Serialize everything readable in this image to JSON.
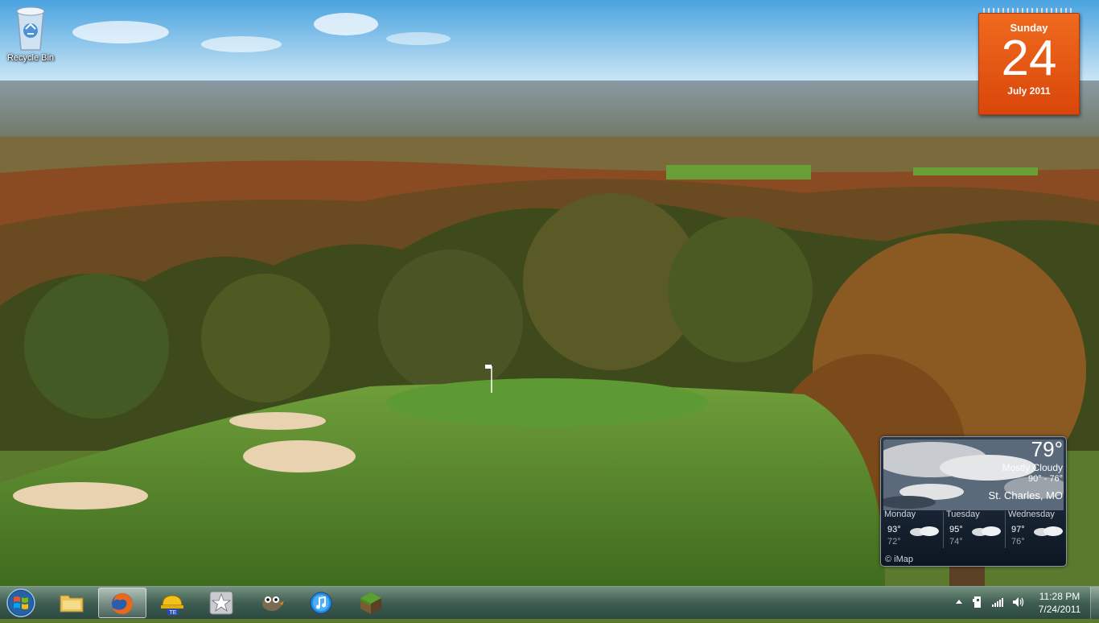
{
  "desktop": {
    "icons": [
      {
        "label": "Recycle Bin",
        "icon": "recycle-bin-icon"
      }
    ]
  },
  "calendar": {
    "weekday": "Sunday",
    "day": "24",
    "month_year": "July 2011"
  },
  "weather": {
    "temperature": "79°",
    "condition": "Mostly Cloudy",
    "range": "90° - 76°",
    "location": "St. Charles, MO",
    "forecast": [
      {
        "day": "Monday",
        "high": "93°",
        "low": "72°"
      },
      {
        "day": "Tuesday",
        "high": "95°",
        "low": "74°"
      },
      {
        "day": "Wednesday",
        "high": "97°",
        "low": "76°"
      }
    ],
    "credit": "© iMap"
  },
  "taskbar": {
    "start_icon": "windows-logo-icon",
    "pinned": [
      {
        "name": "windows-explorer",
        "icon": "folder-icon",
        "active": false
      },
      {
        "name": "firefox",
        "icon": "firefox-icon",
        "active": true
      },
      {
        "name": "construction-app",
        "icon": "hardhat-icon",
        "active": false
      },
      {
        "name": "favorites",
        "icon": "star-icon",
        "active": false
      },
      {
        "name": "gimp",
        "icon": "gimp-icon",
        "active": false
      },
      {
        "name": "itunes",
        "icon": "itunes-icon",
        "active": false
      },
      {
        "name": "minecraft",
        "icon": "minecraft-icon",
        "active": false
      }
    ],
    "tray": {
      "icons": [
        "show-hidden-icons-arrow-icon",
        "action-center-icon",
        "network-signal-icon",
        "volume-icon"
      ],
      "time": "11:28 PM",
      "date": "7/24/2011"
    }
  },
  "colors": {
    "calendar_orange": "#e8571a",
    "taskbar_tint": "#3c5a55"
  }
}
